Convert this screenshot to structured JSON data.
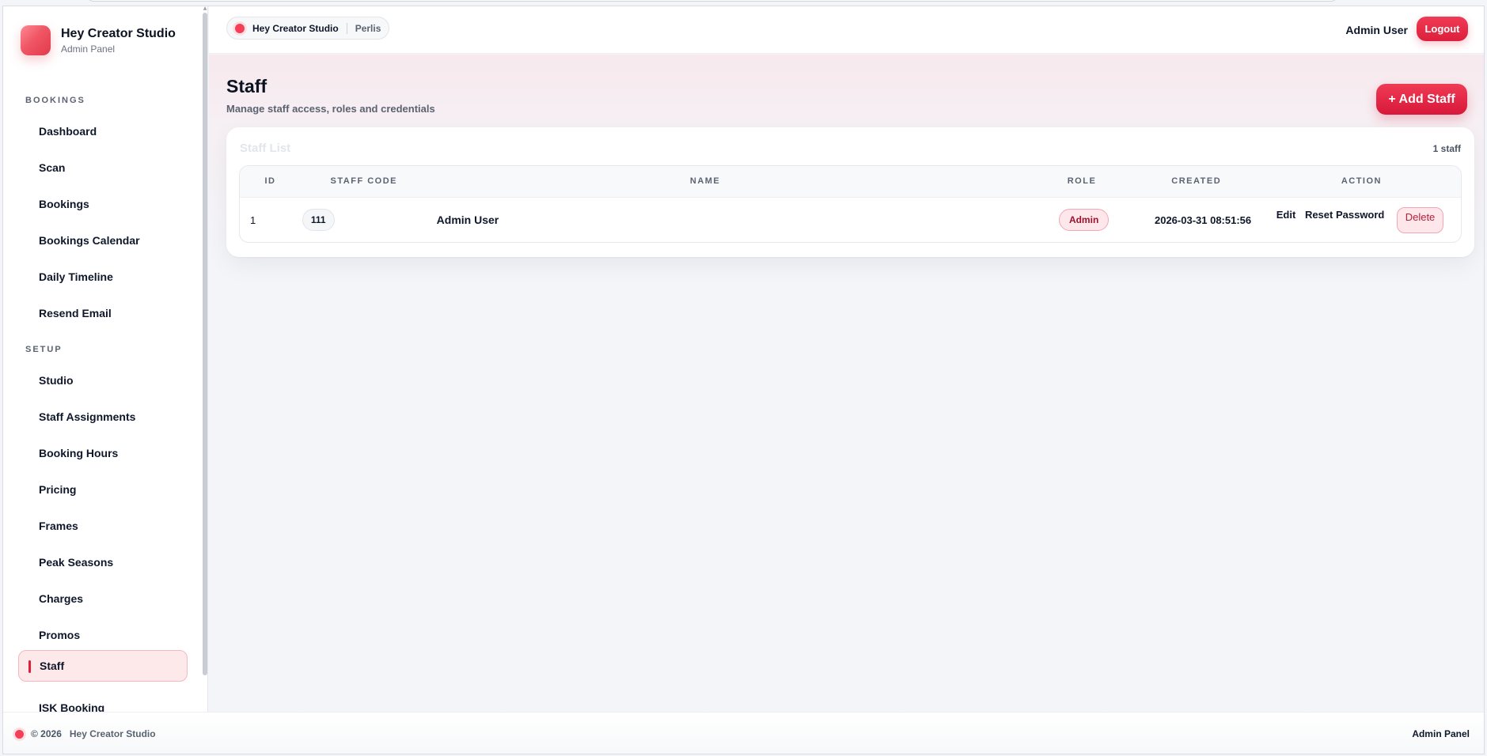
{
  "brand": {
    "name": "Hey Creator Studio",
    "subtitle": "Admin Panel"
  },
  "sidebar": {
    "sections": [
      {
        "label": "BOOKINGS",
        "items": [
          {
            "label": "Dashboard"
          },
          {
            "label": "Scan"
          },
          {
            "label": "Bookings"
          },
          {
            "label": "Bookings Calendar"
          },
          {
            "label": "Daily Timeline"
          },
          {
            "label": "Resend Email"
          }
        ]
      },
      {
        "label": "SETUP",
        "items": [
          {
            "label": "Studio"
          },
          {
            "label": "Staff Assignments"
          },
          {
            "label": "Booking Hours"
          },
          {
            "label": "Pricing"
          },
          {
            "label": "Frames"
          },
          {
            "label": "Peak Seasons"
          },
          {
            "label": "Charges"
          },
          {
            "label": "Promos"
          },
          {
            "label": "Staff",
            "active": true
          },
          {
            "label": "ISK Booking"
          }
        ]
      }
    ]
  },
  "topbar": {
    "studio": "Hey Creator Studio",
    "location": "Perlis",
    "user": "Admin User",
    "logout_label": "Logout"
  },
  "page": {
    "title": "Staff",
    "subtitle": "Manage staff access, roles and credentials",
    "add_label": "+ Add Staff"
  },
  "card": {
    "title": "Staff List",
    "count": "1 staff",
    "columns": [
      "ID",
      "STAFF CODE",
      "NAME",
      "ROLE",
      "CREATED",
      "ACTION"
    ],
    "rows": [
      {
        "id": "1",
        "code": "111",
        "name": "Admin User",
        "role": "Admin",
        "created": "2026-03-31 08:51:56",
        "actions": {
          "edit": "Edit",
          "reset": "Reset Password",
          "delete": "Delete"
        }
      }
    ]
  },
  "footer": {
    "copyright": "© 2026",
    "studio": "Hey Creator Studio",
    "right": "Admin Panel"
  },
  "colors": {
    "accent": "#e11d3a",
    "accent_soft": "#fde7ea",
    "background": "#f4f5f9"
  }
}
